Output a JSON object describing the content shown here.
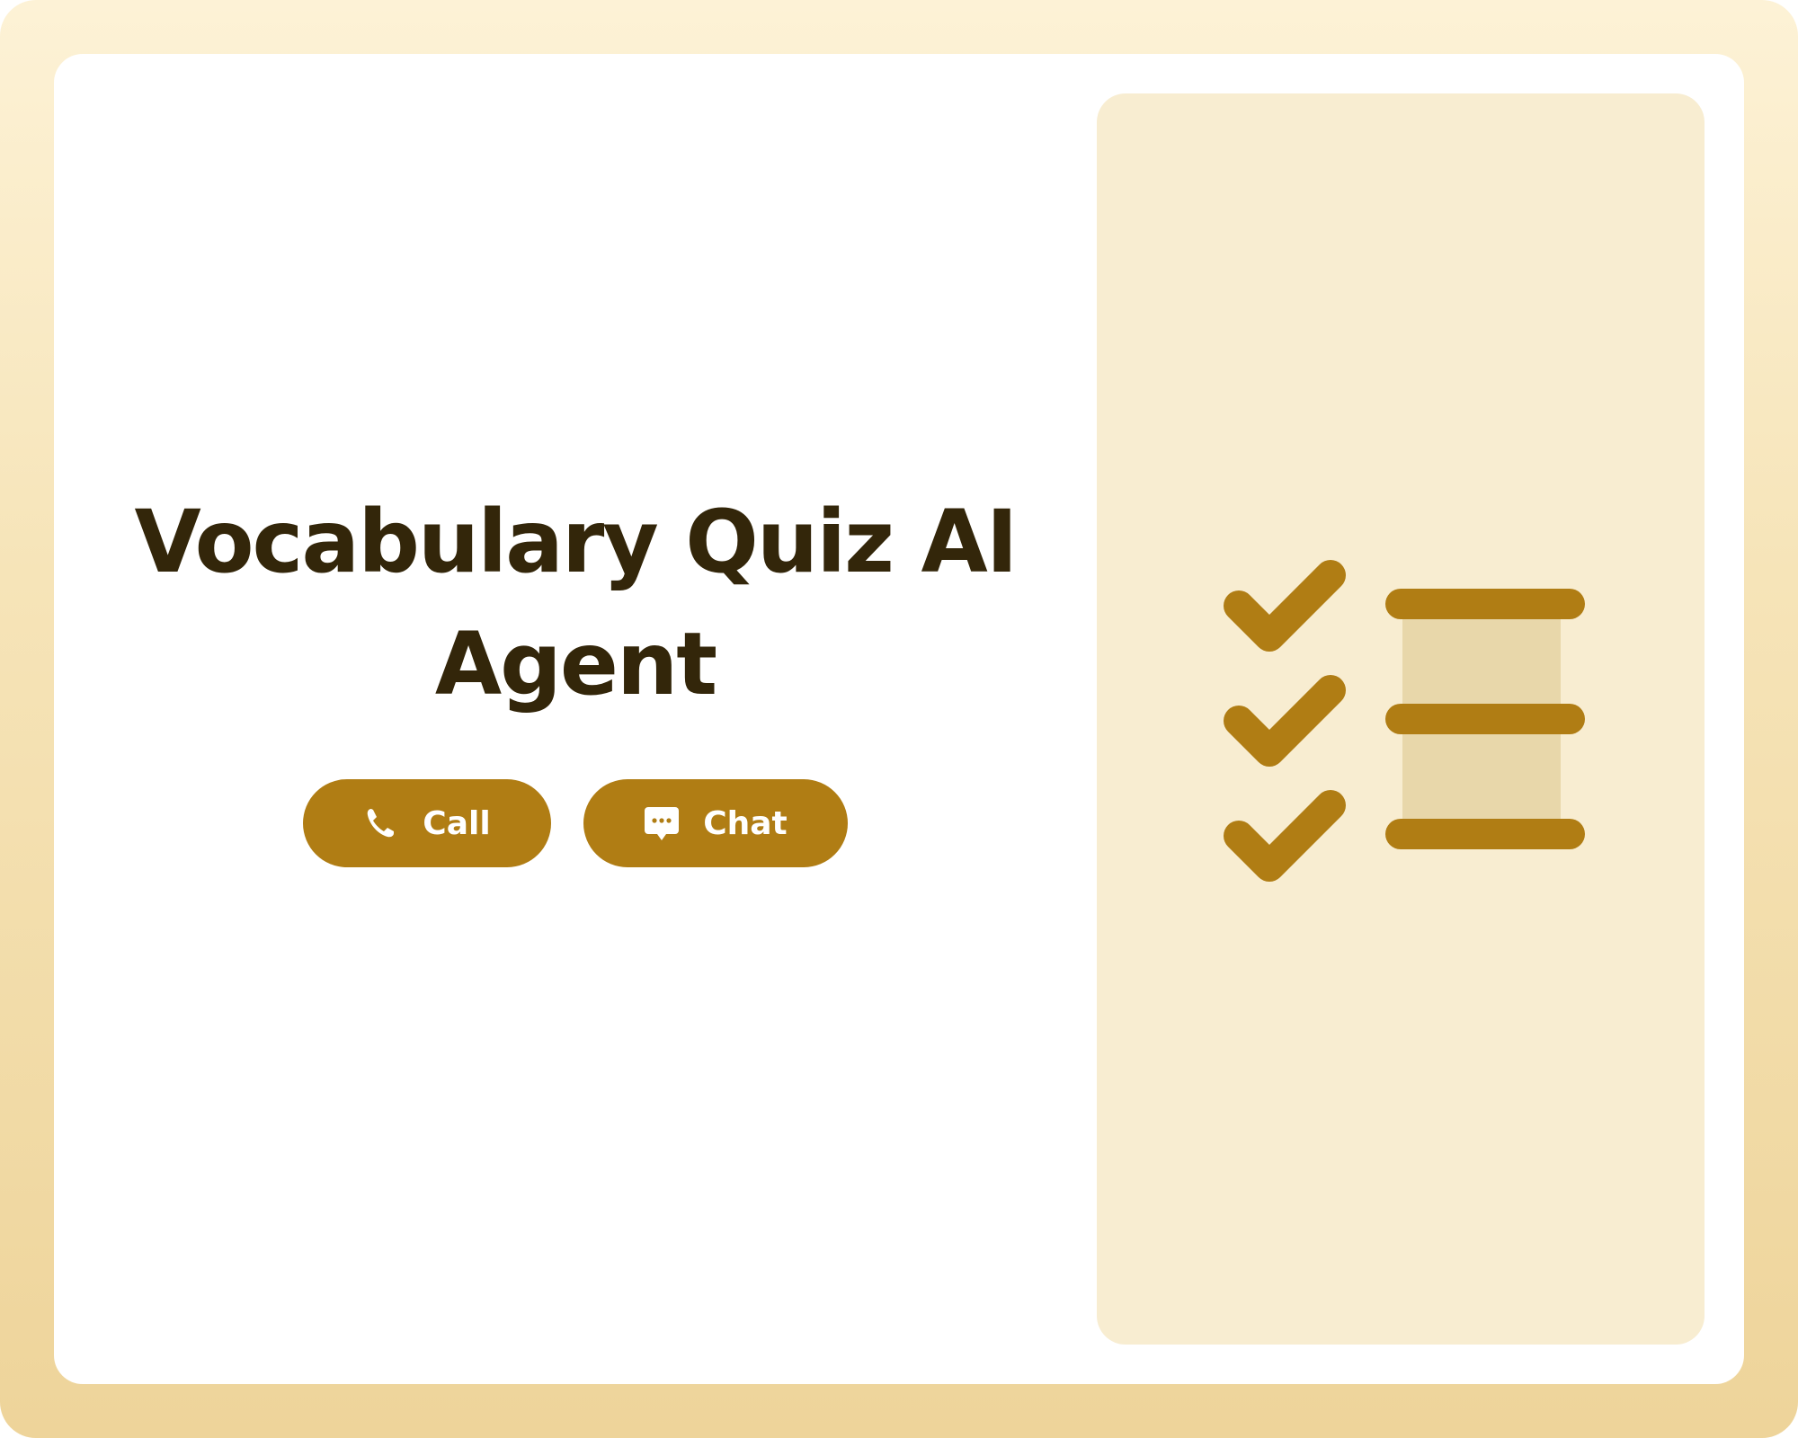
{
  "title": "Vocabulary Quiz AI Agent",
  "buttons": {
    "call": {
      "label": "Call",
      "icon": "phone-icon"
    },
    "chat": {
      "label": "Chat",
      "icon": "chat-icon"
    }
  },
  "illustration": {
    "icon": "checklist-icon",
    "rows": 3
  },
  "colors": {
    "accent": "#b07d14",
    "title": "#33260a",
    "panel": "#f8edd1",
    "column": "#e8d7aa",
    "background_top": "#fdf2d6",
    "background_bottom": "#eed49a"
  }
}
